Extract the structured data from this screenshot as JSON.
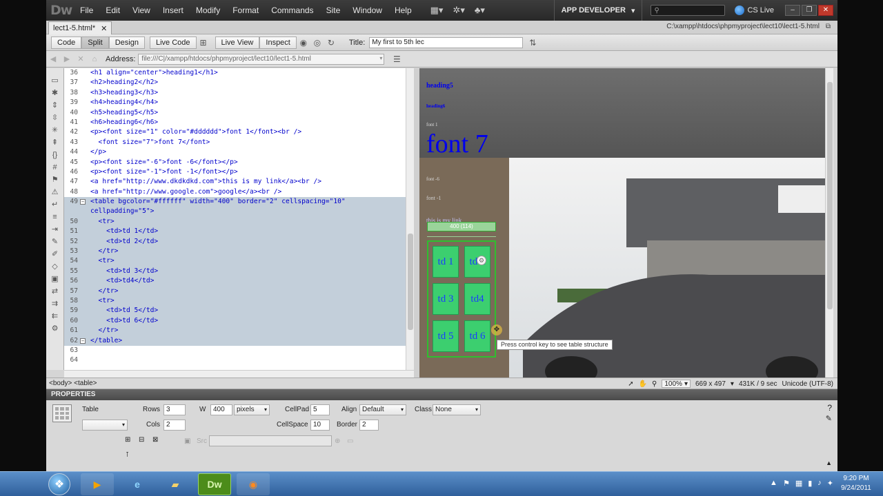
{
  "menubar": {
    "logo": "Dw",
    "items": [
      "File",
      "Edit",
      "View",
      "Insert",
      "Modify",
      "Format",
      "Commands",
      "Site",
      "Window",
      "Help"
    ],
    "workspace": "APP DEVELOPER",
    "search_placeholder": "",
    "cslive": "CS Live"
  },
  "doc": {
    "tab": "lect1-5.html*",
    "path": "C:\\xampp\\htdocs\\phpmyproject\\lect10\\lect1-5.html"
  },
  "toolbar": {
    "code": "Code",
    "split": "Split",
    "design": "Design",
    "live_code": "Live Code",
    "live_view": "Live View",
    "inspect": "Inspect",
    "title_label": "Title:",
    "title_value": "My first to 5th lec"
  },
  "address": {
    "label": "Address:",
    "value": "file:///C|/xampp/htdocs/phpmyproject/lect10/lect1-5.html"
  },
  "code_lines": [
    {
      "n": "36",
      "t": "<h1 align=\"center\">heading1</h1>",
      "sel": false,
      "fold": ""
    },
    {
      "n": "37",
      "t": "<h2>heading2</h2>",
      "sel": false,
      "fold": ""
    },
    {
      "n": "38",
      "t": "<h3>heading3</h3>",
      "sel": false,
      "fold": ""
    },
    {
      "n": "39",
      "t": "<h4>heading4</h4>",
      "sel": false,
      "fold": ""
    },
    {
      "n": "40",
      "t": "<h5>heading5</h5>",
      "sel": false,
      "fold": ""
    },
    {
      "n": "41",
      "t": "<h6>heading6</h6>",
      "sel": false,
      "fold": ""
    },
    {
      "n": "42",
      "t": "<p><font size=\"1\" color=\"#dddddd\">font 1</font><br />",
      "sel": false,
      "fold": ""
    },
    {
      "n": "43",
      "t": "  <font size=\"7\">font 7</font>",
      "sel": false,
      "fold": ""
    },
    {
      "n": "44",
      "t": "</p>",
      "sel": false,
      "fold": ""
    },
    {
      "n": "45",
      "t": "<p><font size=\"-6\">font -6</font></p>",
      "sel": false,
      "fold": ""
    },
    {
      "n": "46",
      "t": "<p><font size=\"-1\">font -1</font></p>",
      "sel": false,
      "fold": ""
    },
    {
      "n": "47",
      "t": "<a href=\"http://www.dkdkdkd.com\">this is my link</a><br />",
      "sel": false,
      "fold": ""
    },
    {
      "n": "48",
      "t": "<a href=\"http://www.google.com\">google</a><br />",
      "sel": false,
      "fold": ""
    },
    {
      "n": "49",
      "t": "<table bgcolor=\"#ffffff\" width=\"400\" border=\"2\" cellspacing=\"10\"",
      "sel": true,
      "fold": "−"
    },
    {
      "n": "",
      "t": "cellpadding=\"5\">",
      "sel": true,
      "fold": ""
    },
    {
      "n": "50",
      "t": "  <tr>",
      "sel": true,
      "fold": ""
    },
    {
      "n": "51",
      "t": "    <td>td 1</td>",
      "sel": true,
      "fold": ""
    },
    {
      "n": "52",
      "t": "    <td>td 2</td>",
      "sel": true,
      "fold": ""
    },
    {
      "n": "53",
      "t": "  </tr>",
      "sel": true,
      "fold": ""
    },
    {
      "n": "54",
      "t": "  <tr>",
      "sel": true,
      "fold": ""
    },
    {
      "n": "55",
      "t": "    <td>td 3</td>",
      "sel": true,
      "fold": ""
    },
    {
      "n": "56",
      "t": "    <td>td4</td>",
      "sel": true,
      "fold": ""
    },
    {
      "n": "57",
      "t": "  </tr>",
      "sel": true,
      "fold": ""
    },
    {
      "n": "58",
      "t": "  <tr>",
      "sel": true,
      "fold": ""
    },
    {
      "n": "59",
      "t": "    <td>td 5</td>",
      "sel": true,
      "fold": ""
    },
    {
      "n": "60",
      "t": "    <td>td 6</td>",
      "sel": true,
      "fold": ""
    },
    {
      "n": "61",
      "t": "  </tr>",
      "sel": true,
      "fold": ""
    },
    {
      "n": "62",
      "t": "</table>",
      "sel": true,
      "fold": "−"
    },
    {
      "n": "63",
      "t": "",
      "sel": false,
      "fold": ""
    },
    {
      "n": "64",
      "t": "",
      "sel": false,
      "fold": ""
    }
  ],
  "design": {
    "heading5": "heading5",
    "heading6": "heading6",
    "font1": "font 1",
    "font7": "font 7",
    "font_m6": "font -6",
    "font_m1": "font -1",
    "link": "this is my link",
    "table_width": "400 (114)",
    "cells": [
      "td 1",
      "td 2",
      "td 3",
      "td4",
      "td 5",
      "td 6"
    ],
    "tooltip": "Press control key to see table structure"
  },
  "statusbar": {
    "tag_selector": "<body> <table>",
    "zoom": "100%",
    "dimensions": "669 x 497",
    "size_time": "431K / 9 sec",
    "encoding": "Unicode (UTF-8)"
  },
  "properties": {
    "header": "PROPERTIES",
    "type_label": "Table",
    "rows_label": "Rows",
    "rows": "3",
    "cols_label": "Cols",
    "cols": "2",
    "w_label": "W",
    "w": "400",
    "w_unit": "pixels",
    "cellpad_label": "CellPad",
    "cellpad": "5",
    "cellspace_label": "CellSpace",
    "cellspace": "10",
    "align_label": "Align",
    "align": "Default",
    "border_label": "Border",
    "border": "2",
    "class_label": "Class",
    "class": "None",
    "src_label": "Src"
  },
  "taskbar": {
    "time": "9:20 PM",
    "date": "9/24/2011",
    "dw_label": "Dw"
  },
  "colors": {
    "selection": "#c3cfda",
    "tag_blue": "#0000cc",
    "cell_green": "#3ccf6f"
  }
}
